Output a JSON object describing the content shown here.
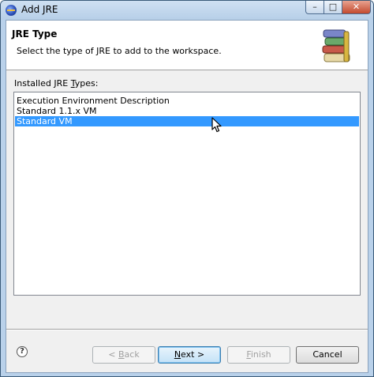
{
  "window": {
    "title": "Add JRE",
    "controls": {
      "minimize": "–",
      "maximize": "□",
      "close": "✕"
    }
  },
  "banner": {
    "title": "JRE Type",
    "description": "Select the type of JRE to add to the workspace.",
    "icon": "books-icon"
  },
  "list": {
    "label_pre": "Installed JRE ",
    "label_mnemonic": "T",
    "label_post": "ypes:",
    "items": [
      "Execution Environment Description",
      "Standard 1.1.x VM",
      "Standard VM"
    ],
    "selected": "Standard VM"
  },
  "footer": {
    "help": "?",
    "back": {
      "pre": "< ",
      "mnemonic": "B",
      "post": "ack",
      "enabled": false
    },
    "next": {
      "pre": "",
      "mnemonic": "N",
      "post": "ext >",
      "enabled": true
    },
    "finish": {
      "pre": "",
      "mnemonic": "F",
      "post": "inish",
      "enabled": false
    },
    "cancel": {
      "label": "Cancel",
      "enabled": true
    }
  },
  "colors": {
    "selection": "#3399ff",
    "titlebar": "#b9d1ea",
    "dialog": "#f0f0f0"
  }
}
